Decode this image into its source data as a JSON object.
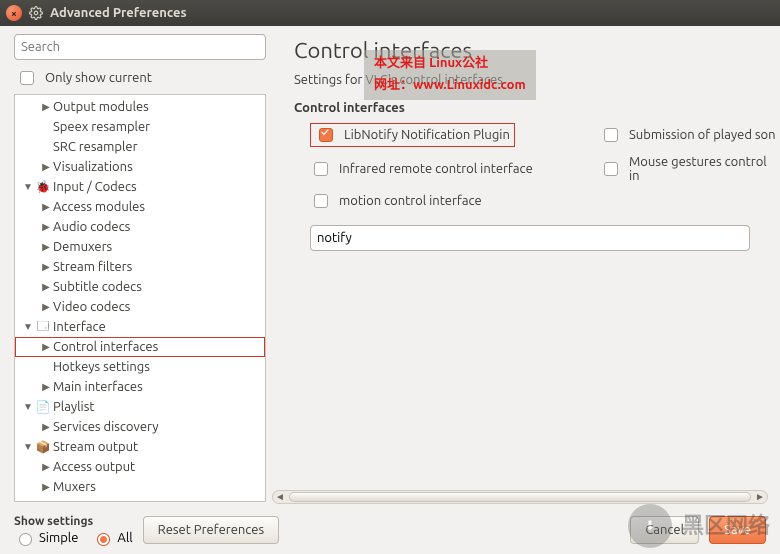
{
  "window": {
    "title": "Advanced Preferences"
  },
  "left": {
    "search_placeholder": "Search",
    "only_show_current": "Only show current",
    "tree": [
      {
        "depth": 1,
        "arrow": "▶",
        "icon": "",
        "label": "Output modules"
      },
      {
        "depth": 1,
        "arrow": "",
        "icon": "",
        "label": "Speex resampler"
      },
      {
        "depth": 1,
        "arrow": "",
        "icon": "",
        "label": "SRC resampler"
      },
      {
        "depth": 1,
        "arrow": "▶",
        "icon": "",
        "label": "Visualizations"
      },
      {
        "depth": 0,
        "arrow": "▼",
        "icon": "🐞",
        "label": "Input / Codecs"
      },
      {
        "depth": 1,
        "arrow": "▶",
        "icon": "",
        "label": "Access modules"
      },
      {
        "depth": 1,
        "arrow": "▶",
        "icon": "",
        "label": "Audio codecs"
      },
      {
        "depth": 1,
        "arrow": "▶",
        "icon": "",
        "label": "Demuxers"
      },
      {
        "depth": 1,
        "arrow": "▶",
        "icon": "",
        "label": "Stream filters"
      },
      {
        "depth": 1,
        "arrow": "▶",
        "icon": "",
        "label": "Subtitle codecs"
      },
      {
        "depth": 1,
        "arrow": "▶",
        "icon": "",
        "label": "Video codecs"
      },
      {
        "depth": 0,
        "arrow": "▼",
        "icon": "🗔",
        "label": "Interface"
      },
      {
        "depth": 1,
        "arrow": "▶",
        "icon": "",
        "label": "Control interfaces",
        "selected": true
      },
      {
        "depth": 1,
        "arrow": "",
        "icon": "",
        "label": "Hotkeys settings"
      },
      {
        "depth": 1,
        "arrow": "▶",
        "icon": "",
        "label": "Main interfaces"
      },
      {
        "depth": 0,
        "arrow": "▼",
        "icon": "📄",
        "label": "Playlist"
      },
      {
        "depth": 1,
        "arrow": "▶",
        "icon": "",
        "label": "Services discovery"
      },
      {
        "depth": 0,
        "arrow": "▼",
        "icon": "📦",
        "label": "Stream output"
      },
      {
        "depth": 1,
        "arrow": "▶",
        "icon": "",
        "label": "Access output"
      },
      {
        "depth": 1,
        "arrow": "▶",
        "icon": "",
        "label": "Muxers"
      }
    ]
  },
  "right": {
    "heading": "Control interfaces",
    "subtitle": "Settings for VLC's control interfaces",
    "group_label": "Control interfaces",
    "checkboxes": [
      {
        "label": "LibNotify Notification Plugin",
        "checked": true,
        "highlighted": true
      },
      {
        "label": "Submission of played son",
        "checked": false
      },
      {
        "label": "Infrared remote control interface",
        "checked": false
      },
      {
        "label": "Mouse gestures control in",
        "checked": false
      },
      {
        "label": "motion control interface",
        "checked": false
      }
    ],
    "filter_value": "notify"
  },
  "bottom": {
    "show_settings_label": "Show settings",
    "simple": "Simple",
    "all": "All",
    "reset": "Reset Preferences",
    "cancel": "Cancel",
    "save": "Save"
  },
  "watermark": {
    "line1": "本文来自 Linux公社",
    "line2_prefix": "网址：",
    "line2_url": "www.Linuxidc.com"
  },
  "logo_watermark": {
    "glyph": "⬇",
    "text1": "黑区网络"
  }
}
